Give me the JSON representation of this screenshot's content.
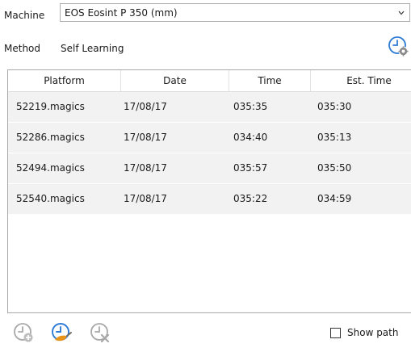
{
  "machine": {
    "label": "Machine",
    "selected": "EOS Eosint P 350 (mm)"
  },
  "method": {
    "label": "Method",
    "value": "Self Learning"
  },
  "table": {
    "columns": [
      "Platform",
      "Date",
      "Time",
      "Est. Time"
    ],
    "rows": [
      {
        "platform": "52219.magics",
        "date": "17/08/17",
        "time": "035:35",
        "est_time": "035:30"
      },
      {
        "platform": "52286.magics",
        "date": "17/08/17",
        "time": "034:40",
        "est_time": "035:13"
      },
      {
        "platform": "52494.magics",
        "date": "17/08/17",
        "time": "035:57",
        "est_time": "035:50"
      },
      {
        "platform": "52540.magics",
        "date": "17/08/17",
        "time": "035:22",
        "est_time": "034:59"
      }
    ]
  },
  "footer": {
    "show_path_label": "Show path",
    "show_path_checked": false
  },
  "icons": {
    "method_settings": "clock-settings-icon",
    "add": "clock-add-icon",
    "edit": "clock-edit-icon",
    "remove": "clock-remove-icon"
  },
  "colors": {
    "accent_blue": "#2e7bd6",
    "accent_orange": "#e8931a",
    "row_bg": "#f2f2f2"
  }
}
